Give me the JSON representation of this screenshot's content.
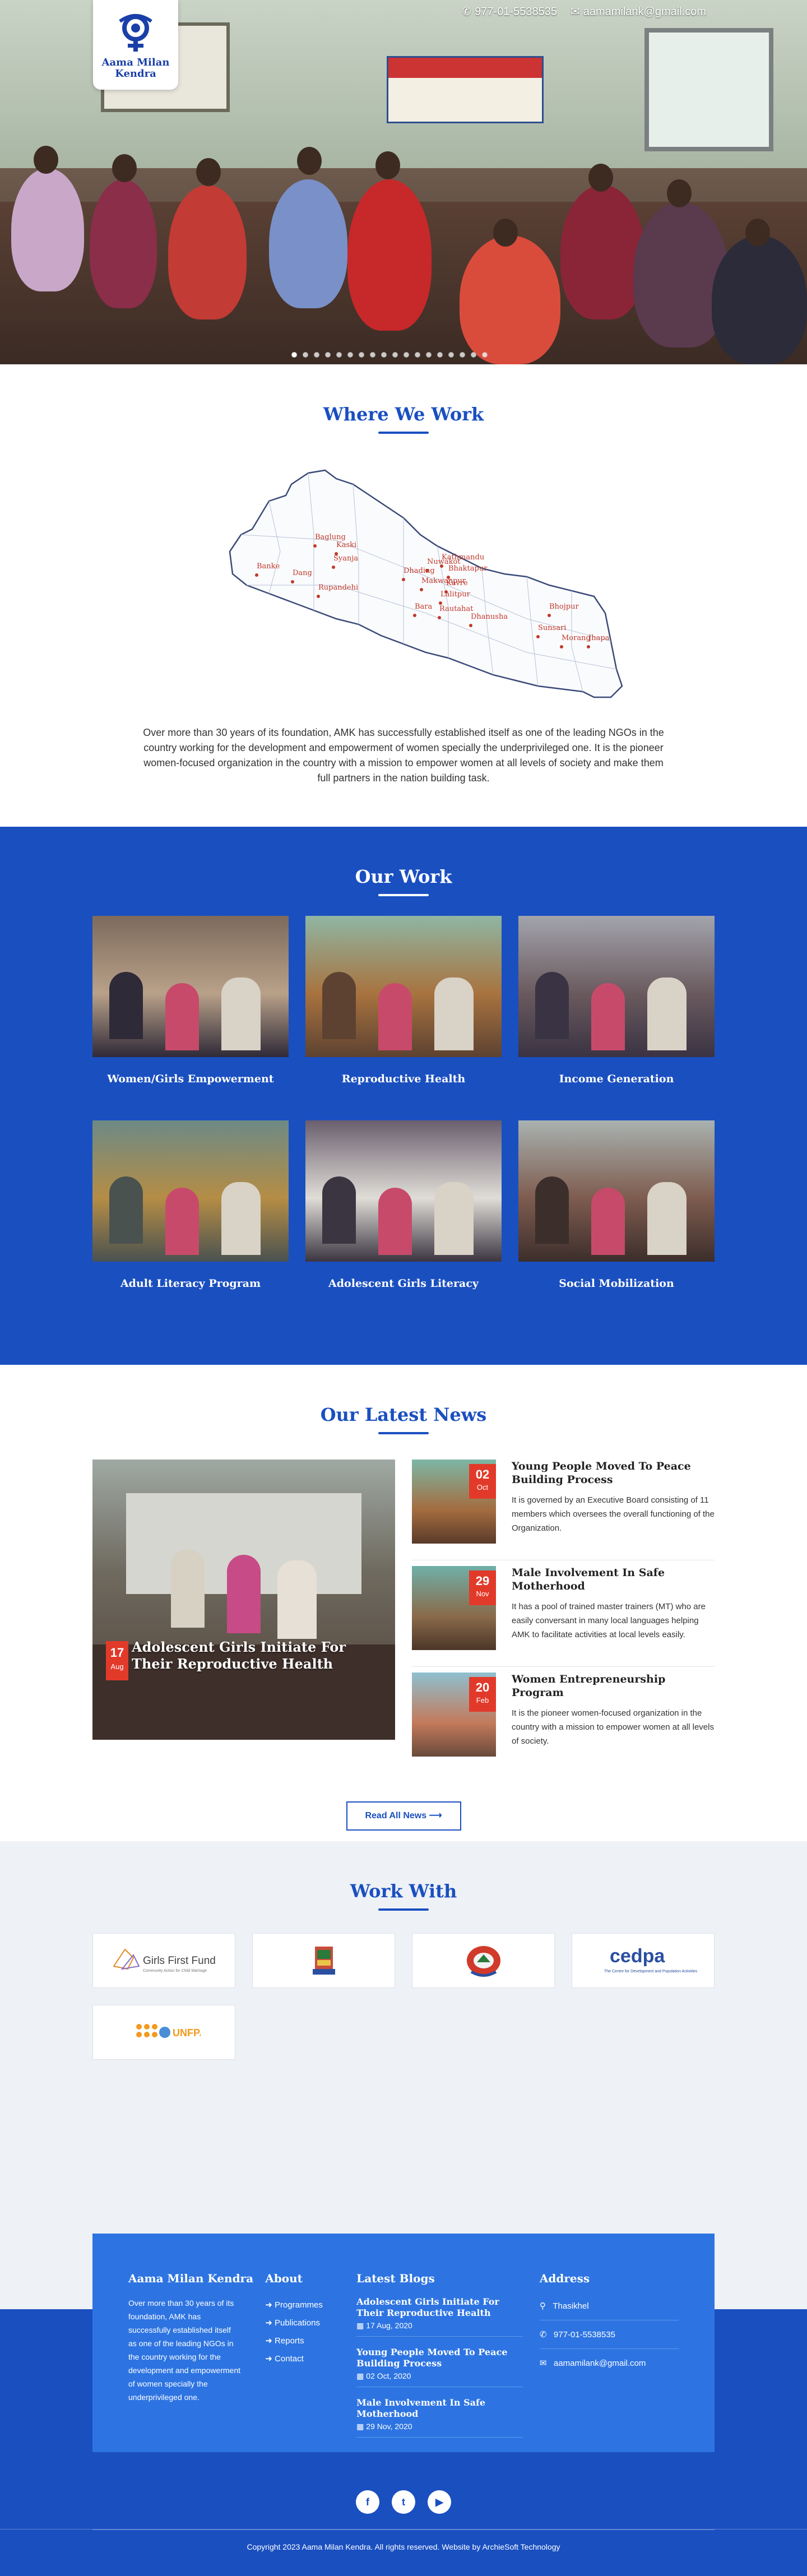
{
  "header": {
    "logo_text": "Aama Milan Kendra",
    "phone": "977-01-5538535",
    "email": "aamamilank@gmail.com"
  },
  "slider": {
    "dot_count": 18,
    "active_index": 0
  },
  "where": {
    "title": "Where We Work",
    "districts": [
      "Kaski",
      "Baglung",
      "Syanja",
      "Banke",
      "Dang",
      "Rupandehi",
      "Dhading",
      "Nuwakot",
      "Kathmandu",
      "Bhaktapur",
      "Makwanpur",
      "Kavre",
      "Lalitpur",
      "Bara",
      "Rautahat",
      "Dhanusha",
      "Sunsari",
      "Bhojpur",
      "Morang",
      "Jhapa"
    ],
    "text": "Over more than 30 years of its foundation, AMK has successfully established itself as one of the leading NGOs in the country working for the development and empowerment of women specially the underprivileged one. It is the pioneer women-focused organization in the country with a mission to empower women at all levels of society and make them full partners in the nation building task."
  },
  "ourwork": {
    "title": "Our Work",
    "items": [
      {
        "label": "Women/Girls Empowerment"
      },
      {
        "label": "Reproductive Health"
      },
      {
        "label": "Income Generation"
      },
      {
        "label": "Adult Literacy Program"
      },
      {
        "label": "Adolescent Girls Literacy"
      },
      {
        "label": "Social Mobilization"
      }
    ]
  },
  "news": {
    "title": "Our Latest News",
    "featured": {
      "title": "Adolescent Girls Initiate For Their Reproductive Health",
      "day": "17",
      "month": "Aug"
    },
    "items": [
      {
        "title": "Young People Moved To Peace Building Process",
        "day": "02",
        "month": "Oct",
        "text": "It is governed by an Executive Board consisting of 11 members which oversees the overall functioning of the Organization."
      },
      {
        "title": "Male Involvement In Safe Motherhood",
        "day": "29",
        "month": "Nov",
        "text": "It has a pool of trained master trainers (MT) who are easily conversant in many local languages helping AMK to facilitate activities at local levels easily."
      },
      {
        "title": "Women Entrepreneurship Program",
        "day": "20",
        "month": "Feb",
        "text": "It is the pioneer women-focused organization in the country with a mission to empower women at all levels of society."
      }
    ],
    "read_all": "Read All News"
  },
  "workwith": {
    "title": "Work With",
    "partners": [
      {
        "name": "Girls First Fund",
        "sub": "Community Action for Child Marriage"
      },
      {
        "name": "emblem"
      },
      {
        "name": "emblem-red"
      },
      {
        "name": "cedpa",
        "sub": "The Centre for Development and Population Activities"
      },
      {
        "name": "UNFPA"
      }
    ]
  },
  "footer": {
    "about_title": "Aama Milan Kendra",
    "about_text": "Over more than 30 years of its foundation, AMK has successfully established itself as one of the leading NGOs in the country working for the development and empowerment of women specially the underprivileged one.",
    "links_title": "About",
    "links": [
      "Programmes",
      "Publications",
      "Reports",
      "Contact"
    ],
    "blogs_title": "Latest Blogs",
    "blogs": [
      {
        "title": "Adolescent Girls Initiate For Their Reproductive Health",
        "date": "17 Aug, 2020"
      },
      {
        "title": "Young People Moved To Peace Building Process",
        "date": "02 Oct, 2020"
      },
      {
        "title": "Male Involvement In Safe Motherhood",
        "date": "29 Nov, 2020"
      }
    ],
    "address_title": "Address",
    "address": "Thasikhel",
    "phone": "977-01-5538535",
    "email": "aamamilank@gmail.com",
    "copyright": "Copyright 2023 Aama Milan Kendra. All rights reserved. Website by ArchieSoft Technology"
  },
  "colors": {
    "primary": "#1a4fc0",
    "footer_box": "#2d74e2",
    "accent_red": "#e23a2a",
    "partners_bg": "#eef1f5"
  }
}
